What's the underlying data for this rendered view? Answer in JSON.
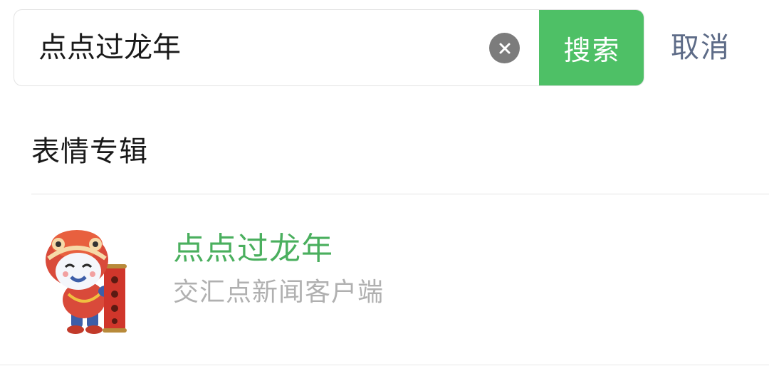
{
  "search": {
    "query": "点点过龙年",
    "search_label": "搜索",
    "cancel_label": "取消"
  },
  "section": {
    "title": "表情专辑"
  },
  "results": [
    {
      "title": "点点过龙年",
      "subtitle": "交汇点新闻客户端",
      "icon": "lion-dance-mascot-sticker"
    }
  ],
  "colors": {
    "accent_green": "#4ec066",
    "result_title_green": "#4aaf5e",
    "cancel_text": "#5d6b87",
    "clear_icon_bg": "#7c7c7c"
  }
}
